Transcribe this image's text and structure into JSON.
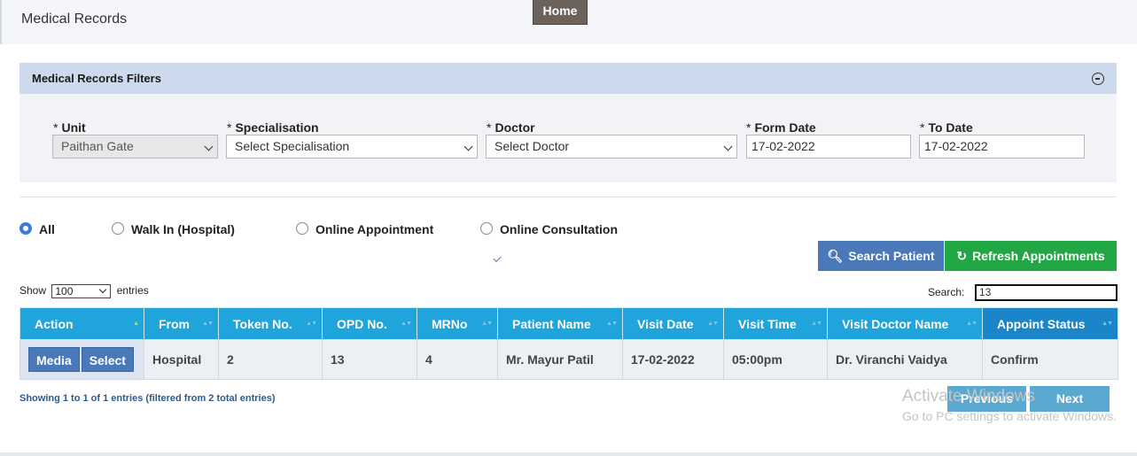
{
  "header": {
    "title": "Medical Records",
    "home_label": "Home"
  },
  "filters": {
    "title": "Medical Records Filters",
    "collapse_icon": "minus-circle-icon",
    "required_marker": "*",
    "unit": {
      "label": "Unit",
      "value": "Paithan Gate"
    },
    "specialisation": {
      "label": "Specialisation",
      "value": "Select Specialisation"
    },
    "doctor": {
      "label": "Doctor",
      "value": "Select Doctor"
    },
    "from_date": {
      "label": "Form Date",
      "value": "17-02-2022"
    },
    "to_date": {
      "label": "To Date",
      "value": "17-02-2022"
    }
  },
  "radios": {
    "selected": "All",
    "items": [
      {
        "label": "All"
      },
      {
        "label": "Walk In (Hospital)"
      },
      {
        "label": "Online Appointment"
      },
      {
        "label": "Online Consultation"
      }
    ]
  },
  "actions": {
    "search_label": "Search Patient",
    "refresh_label": "Refresh Appointments",
    "search_icon": "search-icon",
    "refresh_icon": "refresh-icon"
  },
  "table_controls": {
    "show_label": "Show",
    "entries_label": "entries",
    "page_size": "100",
    "search_label": "Search:",
    "search_value": "13"
  },
  "table": {
    "columns": [
      "Action",
      "From",
      "Token No.",
      "OPD No.",
      "MRNo",
      "Patient Name",
      "Visit Date",
      "Visit Time",
      "Visit Doctor Name",
      "Appoint Status"
    ],
    "rows": [
      {
        "actions": [
          "Media",
          "Select"
        ],
        "from": "Hospital",
        "token": "2",
        "opd": "13",
        "mrno": "4",
        "patient": "Mr. Mayur Patil",
        "visit_date": "17-02-2022",
        "visit_time": "05:00pm",
        "doctor": "Dr. Viranchi Vaidya",
        "status": "Confirm"
      }
    ],
    "info": "Showing 1 to 1 of 1 entries (filtered from 2 total entries)"
  },
  "pagination": {
    "previous": "Previous",
    "next": "Next"
  },
  "watermark": {
    "line1": "Activate Windows",
    "line2": "Go to PC settings to activate Windows."
  },
  "colors": {
    "primary": "#4a78b8",
    "success": "#22a745",
    "table_header": "#1fa4dc"
  }
}
